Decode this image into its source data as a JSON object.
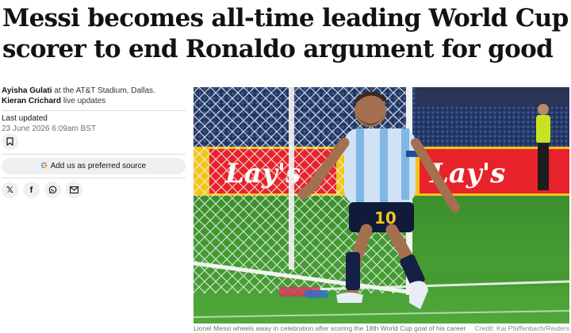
{
  "article": {
    "headline": "Messi becomes all-time leading World Cup scorer to end Ronaldo argument for good",
    "authors": [
      {
        "name": "Ayisha Gulati",
        "detail": "at the AT&T Stadium, Dallas."
      },
      {
        "name": "Kieran Crichard",
        "detail": "live updates"
      }
    ],
    "updated_label": "Last updated",
    "updated_date": "23 June 2026 6:09am BST"
  },
  "actions": {
    "bookmark_icon": "bookmark-icon",
    "preferred_source_label": "Add us as preferred source",
    "google_icon": "google-g-icon",
    "share": [
      {
        "icon": "x-icon",
        "glyph": "𝕏"
      },
      {
        "icon": "facebook-icon",
        "glyph": "f"
      },
      {
        "icon": "whatsapp-icon",
        "glyph": "◌"
      },
      {
        "icon": "email-icon",
        "glyph": "✉"
      }
    ]
  },
  "image": {
    "ad_board_text": "Lay's",
    "shirt_number": "10",
    "caption": "Lionel Messi wheels away in celebration after scoring the 18th World Cup goal of his career",
    "credit": "Credit: Kai Pfaffenbach/Reuters"
  },
  "colors": {
    "ad_board": "#e8222b",
    "ad_board_yellow": "#f4c41a",
    "pitch": "#3f9b2e",
    "crowd": "#1f2a5e"
  }
}
